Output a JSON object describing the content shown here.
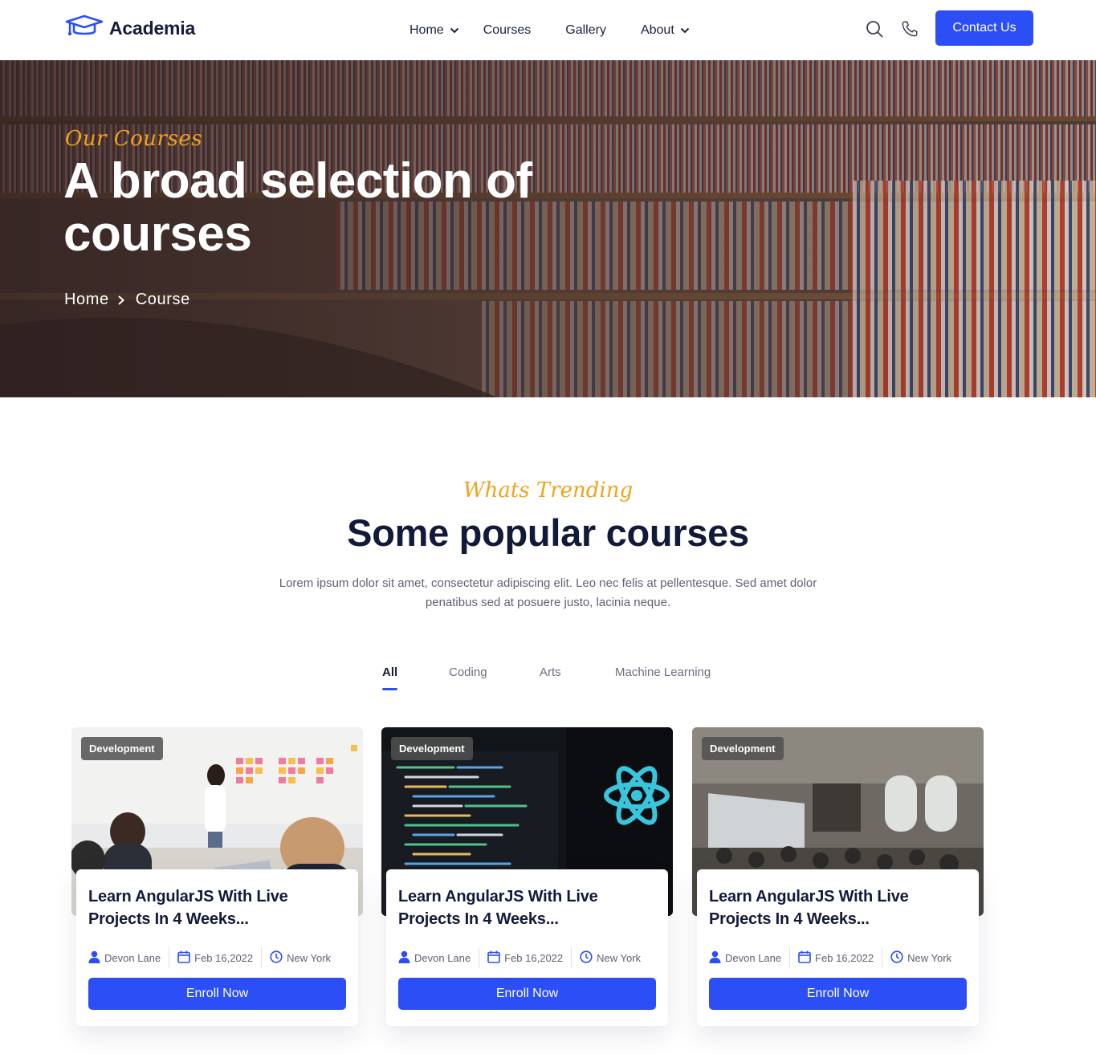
{
  "brand": {
    "name": "Academia",
    "accent": "#2c4ef6",
    "highlight": "#f3a21b"
  },
  "nav": {
    "items": [
      {
        "label": "Home",
        "has_dropdown": true
      },
      {
        "label": "Courses",
        "has_dropdown": false
      },
      {
        "label": "Gallery",
        "has_dropdown": false
      },
      {
        "label": "About",
        "has_dropdown": true
      }
    ],
    "search_icon": "search-icon",
    "phone_icon": "phone-icon",
    "contact_label": "Contact Us"
  },
  "hero": {
    "tag": "Our Courses",
    "title": "A broad selection of courses",
    "breadcrumb": {
      "home": "Home",
      "current": "Course"
    }
  },
  "section": {
    "tag": "Whats Trending",
    "title": "Some popular courses",
    "description": "Lorem ipsum dolor sit amet, consectetur adipiscing elit. Leo nec felis at pellentesque. Sed amet dolor penatibus sed at posuere justo, lacinia neque."
  },
  "tabs": [
    {
      "label": "All",
      "active": true
    },
    {
      "label": "Coding",
      "active": false
    },
    {
      "label": "Arts",
      "active": false
    },
    {
      "label": "Machine Learning",
      "active": false
    }
  ],
  "courses": [
    {
      "badge": "Development",
      "title": "Learn AngularJS With Live Projects In 4 Weeks...",
      "author": "Devon Lane",
      "date": "Feb 16,2022",
      "location": "New York",
      "cta": "Enroll Now"
    },
    {
      "badge": "Development",
      "title": "Learn AngularJS With Live Projects In 4 Weeks...",
      "author": "Devon Lane",
      "date": "Feb 16,2022",
      "location": "New York",
      "cta": "Enroll Now"
    },
    {
      "badge": "Development",
      "title": "Learn AngularJS With Live Projects In 4 Weeks...",
      "author": "Devon Lane",
      "date": "Feb 16,2022",
      "location": "New York",
      "cta": "Enroll Now"
    }
  ]
}
